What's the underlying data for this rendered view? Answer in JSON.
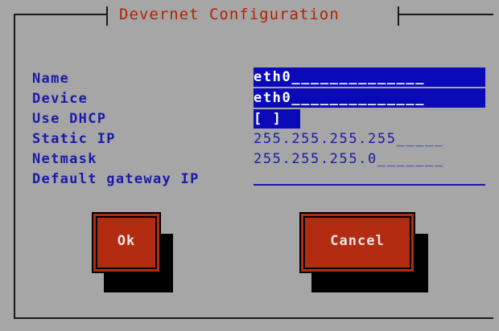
{
  "dialog": {
    "title": "Devernet Configuration"
  },
  "fields": [
    {
      "label": "Name",
      "value": "eth0",
      "pad": "______________"
    },
    {
      "label": "Device",
      "value": "eth0",
      "pad": "______________"
    },
    {
      "label": "Use DHCP",
      "value": "[ ]"
    },
    {
      "label": "Static IP",
      "value": "255.255.255.255",
      "pad": "_____"
    },
    {
      "label": "Netmask",
      "value": "255.255.255.0",
      "pad": "_______"
    },
    {
      "label": "Default gateway IP",
      "value": ""
    }
  ],
  "buttons": {
    "ok": "Ok",
    "cancel": "Cancel"
  },
  "colors": {
    "background": "#a6a6a6",
    "title": "#b22200",
    "label": "#1a1aa8",
    "field_selected": "#0a0ab8",
    "button": "#b32b10",
    "button_text": "#e8e8e8",
    "shadow": "#000000"
  }
}
